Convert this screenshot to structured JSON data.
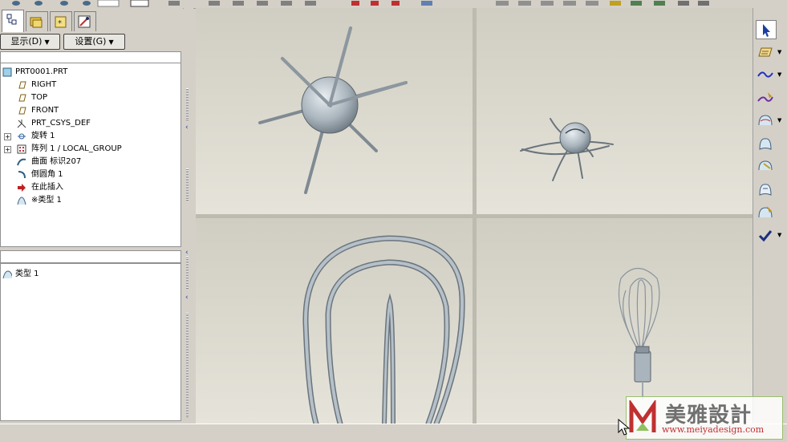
{
  "left_panel": {
    "menus": {
      "show": "显示(D)",
      "settings": "设置(G)"
    },
    "model_tree": [
      {
        "name": "PRT0001.PRT",
        "icon": "part-icon",
        "expandable": false,
        "indent": 0
      },
      {
        "name": "RIGHT",
        "icon": "datum-plane-icon",
        "expandable": false,
        "indent": 1
      },
      {
        "name": "TOP",
        "icon": "datum-plane-icon",
        "expandable": false,
        "indent": 1
      },
      {
        "name": "FRONT",
        "icon": "datum-plane-icon",
        "expandable": false,
        "indent": 1
      },
      {
        "name": "PRT_CSYS_DEF",
        "icon": "csys-icon",
        "expandable": false,
        "indent": 1
      },
      {
        "name": "旋转 1",
        "icon": "revolve-icon",
        "expandable": true,
        "indent": 1
      },
      {
        "name": "阵列 1 / LOCAL_GROUP",
        "icon": "pattern-icon",
        "expandable": true,
        "indent": 1
      },
      {
        "name": "曲面 标识207",
        "icon": "surface-icon",
        "expandable": false,
        "indent": 1
      },
      {
        "name": "倒圆角 1",
        "icon": "round-icon",
        "expandable": false,
        "indent": 1
      },
      {
        "name": "在此插入",
        "icon": "insert-here-icon",
        "expandable": false,
        "indent": 1
      },
      {
        "name": "※类型 1",
        "icon": "boundary-blend-icon",
        "expandable": false,
        "indent": 1
      }
    ],
    "layer_item": "类型 1"
  },
  "right_toolbar": [
    {
      "name": "select-arrow-icon",
      "dropdown": false
    },
    {
      "name": "sketched-datum-icon",
      "dropdown": true
    },
    {
      "name": "datum-curve-icon",
      "dropdown": true
    },
    {
      "name": "sketch-curve-icon",
      "dropdown": false
    },
    {
      "name": "style-surface-icon",
      "dropdown": true
    },
    {
      "name": "boundary-surface-icon",
      "dropdown": false
    },
    {
      "name": "surface-trim-icon",
      "dropdown": false
    },
    {
      "name": "surface-edit-icon",
      "dropdown": false
    },
    {
      "name": "surface-analysis-icon",
      "dropdown": false
    },
    {
      "name": "confirm-check-icon",
      "dropdown": true
    }
  ],
  "watermark": {
    "title": "美雅設計",
    "url": "www.meiyadesign.com"
  },
  "colors": {
    "model": "#a9b4bc",
    "model_edge": "#5a646c",
    "accent": "#1a3fa0",
    "viewport_bg": "#dcd9cf"
  }
}
